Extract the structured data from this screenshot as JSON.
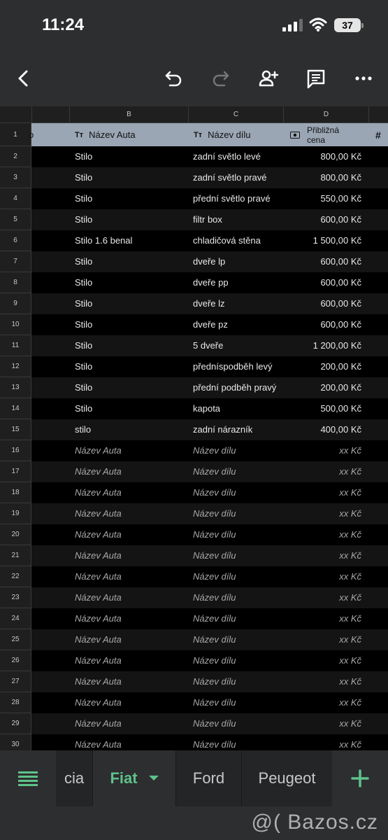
{
  "status_bar": {
    "time": "11:24",
    "battery": "37"
  },
  "toolbar": {
    "back_icon": "back-arrow-icon",
    "undo_icon": "undo-icon",
    "redo_icon": "redo-icon",
    "share_icon": "add-person-icon",
    "comment_icon": "comment-icon",
    "more_icon": "more-icon"
  },
  "columns": {
    "a_fragment": "o",
    "b": "B",
    "c": "C",
    "d": "D"
  },
  "header_row": {
    "row_num": "1",
    "b_label": "Název Auta",
    "c_label": "Název dílu",
    "d_label_line1": "Přibližná",
    "d_label_line2": "cena",
    "e_fragment": "#",
    "text_type_icon": "Tт"
  },
  "rows": [
    {
      "n": "2",
      "b": "Stilo",
      "c": "zadní světlo levé",
      "d": "800,00 Kč",
      "ph": false
    },
    {
      "n": "3",
      "b": "Stilo",
      "c": "zadní světlo pravé",
      "d": "800,00 Kč",
      "ph": false
    },
    {
      "n": "4",
      "b": "Stilo",
      "c": "přední světlo pravé",
      "d": "550,00 Kč",
      "ph": false
    },
    {
      "n": "5",
      "b": "Stilo",
      "c": "filtr box",
      "d": "600,00 Kč",
      "ph": false
    },
    {
      "n": "6",
      "b": " Stilo 1.6 benal",
      "c": "chladičová stěna",
      "d": "1 500,00 Kč",
      "ph": false
    },
    {
      "n": "7",
      "b": "Stilo",
      "c": "dveře lp",
      "d": "600,00 Kč",
      "ph": false
    },
    {
      "n": "8",
      "b": "Stilo",
      "c": "dveře pp",
      "d": "600,00 Kč",
      "ph": false
    },
    {
      "n": "9",
      "b": "Stilo",
      "c": "dveře lz",
      "d": "600,00 Kč",
      "ph": false
    },
    {
      "n": "10",
      "b": "Stilo",
      "c": "dveře pz",
      "d": "600,00 Kč",
      "ph": false
    },
    {
      "n": "11",
      "b": "Stilo",
      "c": "5 dveře",
      "d": "1 200,00 Kč",
      "ph": false
    },
    {
      "n": "12",
      "b": "Stilo",
      "c": "předníspodběh levý",
      "d": "200,00 Kč",
      "ph": false
    },
    {
      "n": "13",
      "b": "Stilo",
      "c": "přední podběh pravý",
      "d": "200,00 Kč",
      "ph": false
    },
    {
      "n": "14",
      "b": "Stilo",
      "c": "kapota",
      "d": "500,00 Kč",
      "ph": false
    },
    {
      "n": "15",
      "b": "stilo",
      "c": "zadní nárazník",
      "d": "400,00 Kč",
      "ph": false
    },
    {
      "n": "16",
      "b": "Název Auta",
      "c": "Název dílu",
      "d": "xx Kč",
      "ph": true
    },
    {
      "n": "17",
      "b": "Název Auta",
      "c": "Název dílu",
      "d": "xx Kč",
      "ph": true
    },
    {
      "n": "18",
      "b": "Název Auta",
      "c": "Název dílu",
      "d": "xx Kč",
      "ph": true
    },
    {
      "n": "19",
      "b": "Název Auta",
      "c": "Název dílu",
      "d": "xx Kč",
      "ph": true
    },
    {
      "n": "20",
      "b": "Název Auta",
      "c": "Název dílu",
      "d": "xx Kč",
      "ph": true
    },
    {
      "n": "21",
      "b": "Název Auta",
      "c": "Název dílu",
      "d": "xx Kč",
      "ph": true
    },
    {
      "n": "22",
      "b": "Název Auta",
      "c": "Název dílu",
      "d": "xx Kč",
      "ph": true
    },
    {
      "n": "23",
      "b": "Název Auta",
      "c": "Název dílu",
      "d": "xx Kč",
      "ph": true
    },
    {
      "n": "24",
      "b": "Název Auta",
      "c": "Název dílu",
      "d": "xx Kč",
      "ph": true
    },
    {
      "n": "25",
      "b": "Název Auta",
      "c": "Název dílu",
      "d": "xx Kč",
      "ph": true
    },
    {
      "n": "26",
      "b": "Název Auta",
      "c": "Název dílu",
      "d": "xx Kč",
      "ph": true
    },
    {
      "n": "27",
      "b": "Název Auta",
      "c": "Název dílu",
      "d": "xx Kč",
      "ph": true
    },
    {
      "n": "28",
      "b": "Název Auta",
      "c": "Název dílu",
      "d": "xx Kč",
      "ph": true
    },
    {
      "n": "29",
      "b": "Název Auta",
      "c": "Název dílu",
      "d": "xx Kč",
      "ph": true
    },
    {
      "n": "30",
      "b": "Název Auta",
      "c": "Název dílu",
      "d": "xx Kč",
      "ph": true
    }
  ],
  "sheet_tabs": {
    "menu_icon": "sheet-list-icon",
    "tab_partial": "cia",
    "tab_active": "Fiat",
    "tab_3": "Ford",
    "tab_4": "Peugeot",
    "add_icon": "add-sheet-icon"
  },
  "watermark": "@( Bazos.cz",
  "colors": {
    "accent": "#5ec28a",
    "header_row_bg": "#9aa6b4",
    "chrome": "#2d2e30"
  }
}
